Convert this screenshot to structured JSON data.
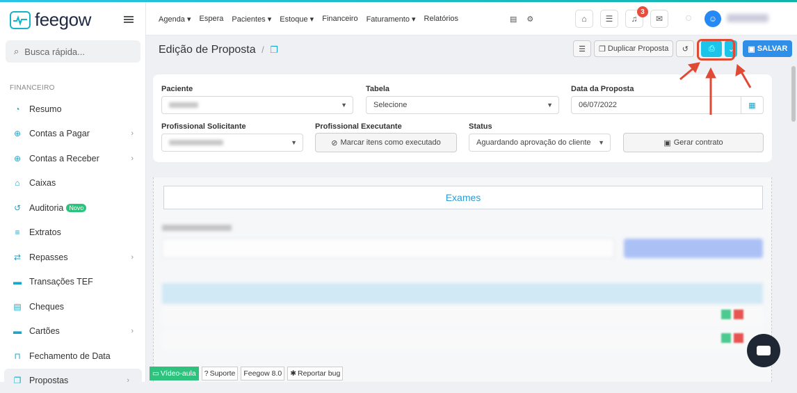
{
  "app": {
    "name": "feegow"
  },
  "search": {
    "placeholder": "Busca rápida..."
  },
  "sidebar": {
    "section": "FINANCEIRO",
    "items": [
      {
        "label": "Resumo",
        "icon": "pie-chart-icon",
        "chev": false
      },
      {
        "label": "Contas a Pagar",
        "icon": "arrow-up-circle-icon",
        "chev": true
      },
      {
        "label": "Contas a Receber",
        "icon": "arrow-down-circle-icon",
        "chev": true
      },
      {
        "label": "Caixas",
        "icon": "inbox-icon",
        "chev": false
      },
      {
        "label": "Auditoria",
        "icon": "history-icon",
        "chev": false,
        "badge": "Novo"
      },
      {
        "label": "Extratos",
        "icon": "list-icon",
        "chev": false
      },
      {
        "label": "Repasses",
        "icon": "transfer-icon",
        "chev": true
      },
      {
        "label": "Transações TEF",
        "icon": "card-icon",
        "chev": false
      },
      {
        "label": "Cheques",
        "icon": "cheque-icon",
        "chev": false
      },
      {
        "label": "Cartões",
        "icon": "card-icon",
        "chev": true
      },
      {
        "label": "Fechamento de Data",
        "icon": "lock-icon",
        "chev": false
      },
      {
        "label": "Propostas",
        "icon": "copy-icon",
        "chev": true,
        "active": true
      }
    ]
  },
  "nav": {
    "items": [
      "Agenda ▾",
      "Espera",
      "Pacientes ▾",
      "Estoque ▾",
      "Financeiro",
      "Faturamento ▾",
      "Relatórios"
    ],
    "notification_count": "3"
  },
  "page": {
    "title": "Edição de Proposta",
    "separator": "/",
    "buttons": {
      "duplicate": "Duplicar Proposta",
      "save": "SALVAR"
    }
  },
  "form": {
    "paciente": {
      "label": "Paciente"
    },
    "tabela": {
      "label": "Tabela",
      "value": "Selecione"
    },
    "data": {
      "label": "Data da Proposta",
      "value": "06/07/2022"
    },
    "prof_sol": {
      "label": "Profissional Solicitante"
    },
    "prof_exec": {
      "label": "Profissional Executante",
      "button": "Marcar itens como executado"
    },
    "status": {
      "label": "Status",
      "value": "Aguardando aprovação do cliente"
    },
    "contract": {
      "label": "Gerar contrato"
    }
  },
  "section": {
    "tab": "Exames"
  },
  "footer": {
    "video": "Vídeo-aula",
    "support": "Suporte",
    "version": "Feegow 8.0",
    "bug": "Reportar bug"
  },
  "colors": {
    "accent": "#1bc4e8",
    "primary": "#2f8ee8",
    "highlight": "#e04a34",
    "success": "#2ec27e"
  }
}
